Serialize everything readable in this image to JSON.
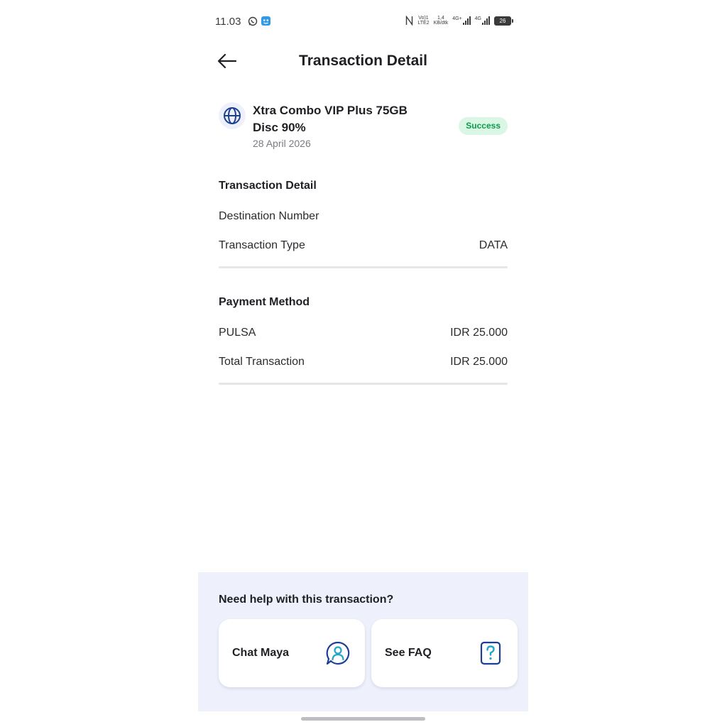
{
  "status_bar": {
    "time": "11.03",
    "network_left_top": "Vo)1",
    "network_left_bottom": "LTE2",
    "speed_top": "1,4",
    "speed_bottom": "KB/dtk",
    "net1": "4G+",
    "net2": "4G",
    "battery": "26"
  },
  "header": {
    "title": "Transaction Detail"
  },
  "product": {
    "name": "Xtra Combo VIP Plus 75GB Disc 90%",
    "date": "28 April 2026",
    "status": "Success",
    "icon": "globe-icon"
  },
  "transaction_section": {
    "title": "Transaction Detail",
    "rows": [
      {
        "label": "Destination Number",
        "value": ""
      },
      {
        "label": "Transaction Type",
        "value": "DATA"
      }
    ]
  },
  "payment_section": {
    "title": "Payment Method",
    "rows": [
      {
        "label": "PULSA",
        "value": "IDR 25.000"
      },
      {
        "label": "Total Transaction",
        "value": "IDR 25.000"
      }
    ]
  },
  "help": {
    "title": "Need help with this transaction?",
    "cards": [
      {
        "label": "Chat Maya",
        "icon": "chat-agent-icon"
      },
      {
        "label": "See FAQ",
        "icon": "question-icon"
      }
    ]
  },
  "colors": {
    "accent": "#1c3f94",
    "success_bg": "#d9f7e4",
    "success_text": "#0e9a4a",
    "help_bg": "#eef1fb"
  }
}
